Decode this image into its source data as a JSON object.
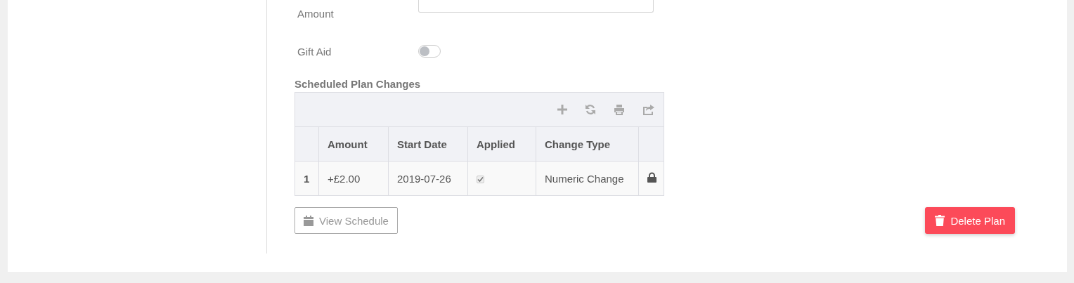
{
  "form": {
    "amount_label": "Amount",
    "gift_aid": {
      "label": "Gift Aid",
      "on": false
    }
  },
  "plan_changes": {
    "title": "Scheduled Plan Changes",
    "columns": [
      "Amount",
      "Start Date",
      "Applied",
      "Change Type"
    ],
    "rows": [
      {
        "index": "1",
        "amount": "+£2.00",
        "start_date": "2019-07-26",
        "applied": true,
        "change_type": "Numeric Change",
        "locked": true
      }
    ]
  },
  "buttons": {
    "view_schedule": "View Schedule",
    "delete_plan": "Delete Plan"
  }
}
